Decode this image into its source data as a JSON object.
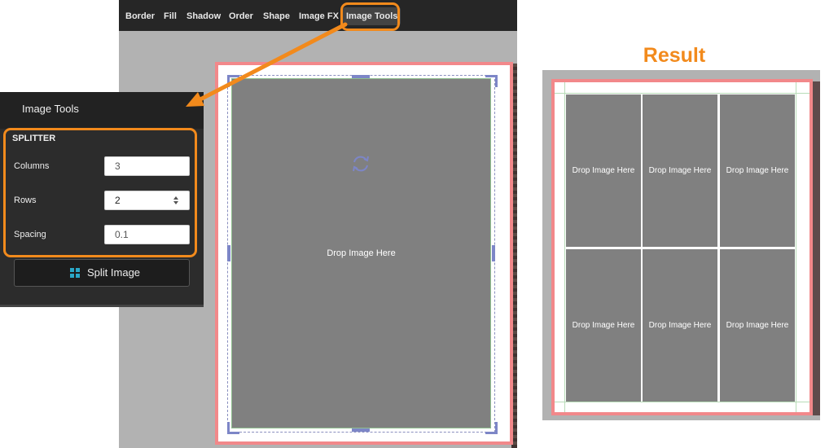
{
  "toolbar": {
    "items": [
      "Border",
      "Fill",
      "Shadow",
      "Order",
      "Shape",
      "Image FX",
      "Image Tools"
    ],
    "active": "Image Tools"
  },
  "editor": {
    "drop_text": "Drop Image Here",
    "icons": [
      "rotate-icon"
    ]
  },
  "panel": {
    "title": "Image Tools",
    "section": "SPLITTER",
    "fields": [
      {
        "label": "Columns",
        "value": "3"
      },
      {
        "label": "Rows",
        "value": "2"
      },
      {
        "label": "Spacing",
        "value": "0.1"
      }
    ],
    "split_button": "Split Image",
    "split_icon": "grid-icon"
  },
  "result": {
    "heading": "Result",
    "columns": 3,
    "rows": 2,
    "tile_text": "Drop Image Here"
  },
  "colors": {
    "accent": "#f28a1c",
    "page_border": "#f2888a",
    "handles": "#7d86c7",
    "toolbar_bg": "#262626",
    "panel_bg": "#2c2c2c",
    "image_placeholder": "#808080"
  }
}
